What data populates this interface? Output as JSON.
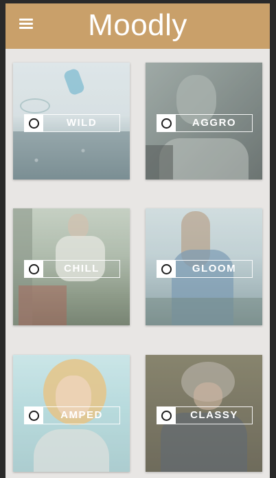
{
  "header": {
    "title": "Moodly",
    "menu_icon": "hamburger-menu-icon"
  },
  "colors": {
    "header_bg": "#c9a06a",
    "page_bg": "#e8e6e4",
    "badge_text": "#ffffff"
  },
  "moods": [
    {
      "label": "WILD",
      "icon": "radio-circle-icon"
    },
    {
      "label": "AGGRO",
      "icon": "radio-circle-icon"
    },
    {
      "label": "CHILL",
      "icon": "radio-circle-icon"
    },
    {
      "label": "GLOOM",
      "icon": "radio-circle-icon"
    },
    {
      "label": "AMPED",
      "icon": "radio-circle-icon"
    },
    {
      "label": "CLASSY",
      "icon": "radio-circle-icon"
    }
  ]
}
